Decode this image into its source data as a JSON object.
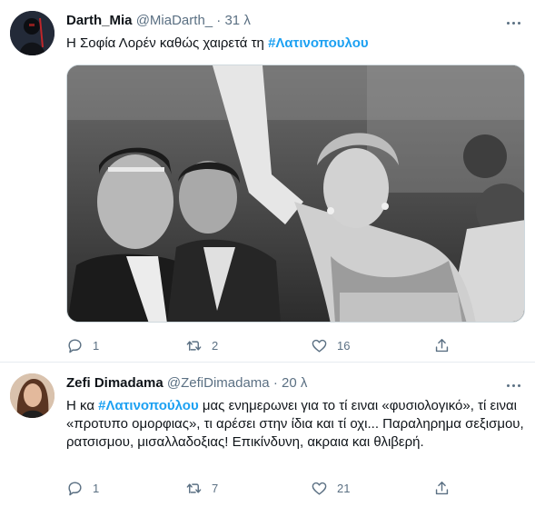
{
  "tweets": [
    {
      "display_name": "Darth_Mia",
      "handle": "@MiaDarth_",
      "separator": "·",
      "time": "31 λ",
      "text_before": "Η Σοφία Λορέν καθώς χαιρετά τη ",
      "hashtag": "#Λατινοπουλου",
      "text_after": "",
      "replies": "1",
      "retweets": "2",
      "likes": "16"
    },
    {
      "display_name": "Zefi Dimadama",
      "handle": "@ZefiDimadama",
      "separator": "·",
      "time": "20 λ",
      "text_before": "Η κα ",
      "hashtag": "#Λατινοπούλου",
      "text_after": " μας ενημερωνει για το τί ειναι «φυσιολογικό», τί ειναι «προτυπο ομορφιας», τι αρέσει στην  ίδια και τί οχι... Παραληρημα σεξισμου, ρατσισμου, μισαλλαδοξιας! Επικίνδυνη, ακραια και θλιβερή.",
      "replies": "1",
      "retweets": "7",
      "likes": "21"
    }
  ],
  "colors": {
    "link": "#1da1f2",
    "muted": "#5b7083",
    "text": "#0f1419",
    "divider": "#e6ecf0"
  },
  "icons": [
    "avatar",
    "more-icon",
    "reply-icon",
    "retweet-icon",
    "like-icon",
    "share-icon"
  ]
}
